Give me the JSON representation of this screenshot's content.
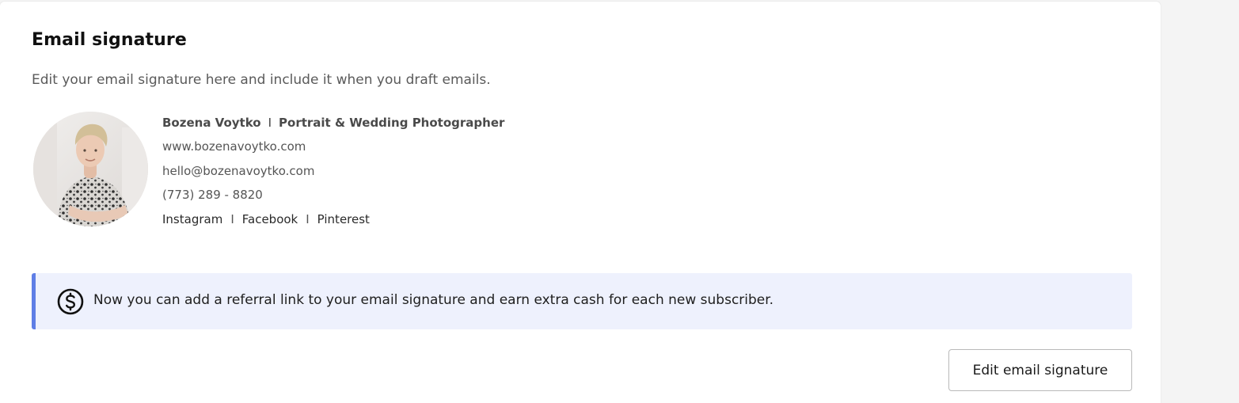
{
  "section": {
    "title": "Email signature",
    "description": "Edit your email signature here and include it when you draft emails."
  },
  "signature": {
    "name": "Bozena Voytko",
    "separator": "I",
    "role": "Portrait & Wedding Photographer",
    "website": "www.bozenavoytko.com",
    "email": "hello@bozenavoytko.com",
    "phone": "(773) 289 - 8820",
    "social": [
      "Instagram",
      "Facebook",
      "Pinterest"
    ],
    "avatar_icon": "profile-photo"
  },
  "banner": {
    "icon": "dollar-circle-icon",
    "text": "Now you can add a referral link to your email signature and earn extra cash for each new subscriber.",
    "accent_color": "#5f7ee6",
    "background_color": "#eef1fd"
  },
  "actions": {
    "edit_label": "Edit email signature"
  }
}
